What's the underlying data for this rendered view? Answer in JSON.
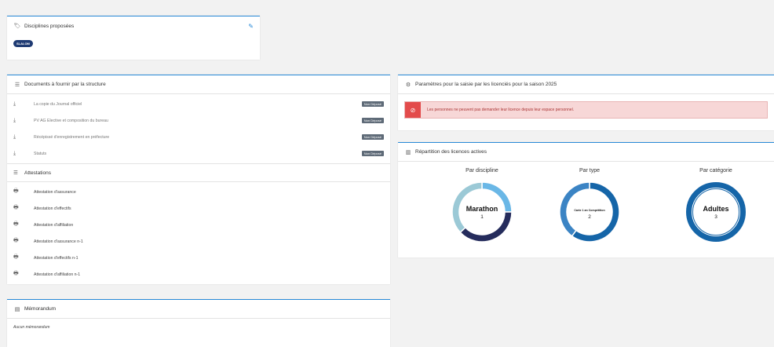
{
  "disciplines": {
    "title": "Disciplines proposées",
    "tag": "SLALOM"
  },
  "documents": {
    "title": "Documents à fournir par la structure",
    "badge": "Non Déposé",
    "items": [
      "La copie du Journal officiel",
      "PV AG Elective et composition du bureau",
      "Récépissé d'enregistrement en préfecture",
      "Statuts"
    ]
  },
  "attestations": {
    "title": "Attestations",
    "items": [
      "Attestation d'assurance",
      "Attestation d'effectifs",
      "Attestation d'affiliation",
      "Attestation d'assurance n-1",
      "Attestation d'effectifs n-1",
      "Attestation d'affiliation n-1"
    ]
  },
  "memorandum": {
    "title": "Mémorandum",
    "empty": "Aucun mémorandum"
  },
  "params": {
    "title": "Paramètres pour la saisie par les licenciés pour la saison 2025",
    "alert": "Les personnes ne peuvent pas demander leur licence depuis leur espace personnel."
  },
  "repartition": {
    "title": "Répartition des licences actives",
    "charts": [
      {
        "title": "Par discipline",
        "label": "Marathon",
        "value": "1",
        "segments": [
          {
            "fraction": 0.25,
            "color": "#6ab7e6"
          },
          {
            "fraction": 0.38,
            "color": "#252c5c"
          },
          {
            "fraction": 0.37,
            "color": "#9bc9d6"
          }
        ]
      },
      {
        "title": "Par type",
        "label": "Carte 1 an Compétition",
        "value": "2",
        "segments": [
          {
            "fraction": 0.6,
            "color": "#1565a8"
          },
          {
            "fraction": 0.4,
            "color": "#3b84c4"
          }
        ]
      },
      {
        "title": "Par catégorie",
        "label": "Adultes",
        "value": "3",
        "segments": [
          {
            "fraction": 1.0,
            "color": "#1565a8"
          }
        ]
      }
    ]
  }
}
